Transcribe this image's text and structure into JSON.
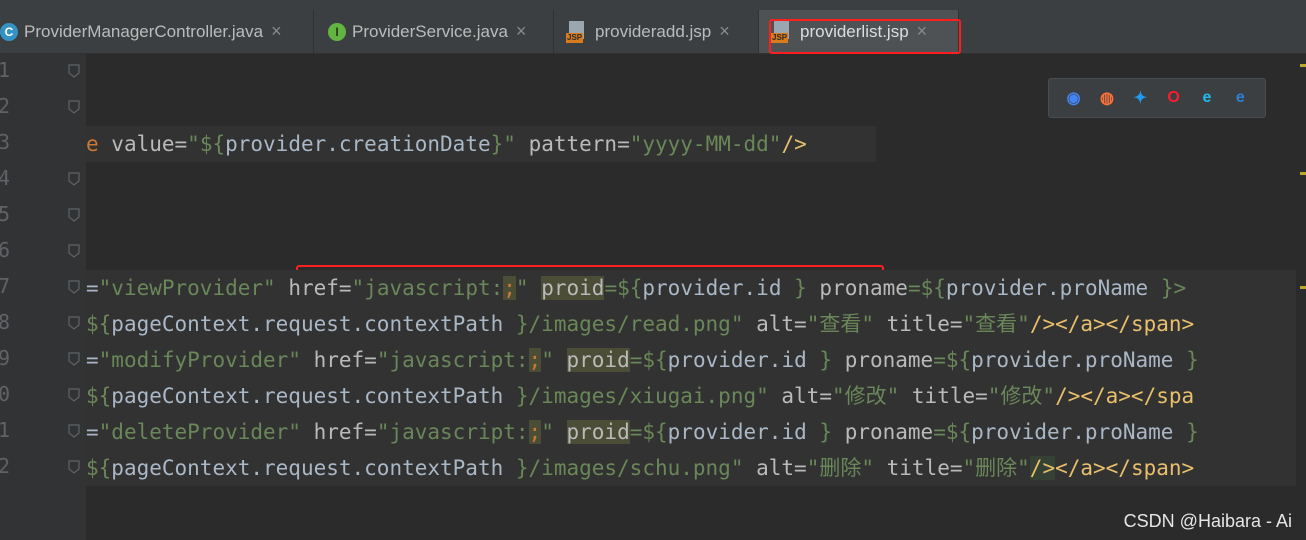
{
  "tabs": [
    {
      "label": "ProviderManagerController.java",
      "icon": "class-c-icon",
      "active": false
    },
    {
      "label": "ProviderService.java",
      "icon": "interface-i-icon",
      "active": false
    },
    {
      "label": "provideradd.jsp",
      "icon": "jsp-file-icon",
      "active": false
    },
    {
      "label": "providerlist.jsp",
      "icon": "jsp-file-icon",
      "active": true
    }
  ],
  "close_glyph": "×",
  "gutter": {
    "line_numbers": [
      "1",
      "2",
      "3",
      "4",
      "5",
      "6",
      "7",
      "8",
      "9",
      "0",
      "1",
      "2"
    ]
  },
  "code_lines": [
    {
      "segments": []
    },
    {
      "segments": []
    },
    {
      "segments": [
        {
          "t": "e",
          "c": "el"
        },
        {
          "t": " value=",
          "c": "attr"
        },
        {
          "t": "\"${",
          "c": "str"
        },
        {
          "t": "provider.creationDate",
          "c": "ident"
        },
        {
          "t": "}\"",
          "c": "str"
        },
        {
          "t": " pattern=",
          "c": "attr"
        },
        {
          "t": "\"yyyy-MM-dd\"",
          "c": "str"
        },
        {
          "t": "/>",
          "c": "tag"
        }
      ]
    },
    {
      "segments": []
    },
    {
      "segments": []
    },
    {
      "segments": []
    },
    {
      "segments": [
        {
          "t": "=",
          "c": "ident"
        },
        {
          "t": "\"viewProvider\"",
          "c": "str"
        },
        {
          "t": " ",
          "c": "ident"
        },
        {
          "t": "href=",
          "c": "attr"
        },
        {
          "t": "\"javascript:",
          "c": "str"
        },
        {
          "t": ";",
          "c": "el hl"
        },
        {
          "t": "\"",
          "c": "str"
        },
        {
          "t": " ",
          "c": "ident"
        },
        {
          "t": "proid",
          "c": "attr hl"
        },
        {
          "t": "=${",
          "c": "str"
        },
        {
          "t": "provider.id",
          "c": "ident"
        },
        {
          "t": " }",
          "c": "str"
        },
        {
          "t": " ",
          "c": "ident"
        },
        {
          "t": "proname",
          "c": "attr"
        },
        {
          "t": "=${",
          "c": "str"
        },
        {
          "t": "provider.proName",
          "c": "ident"
        },
        {
          "t": " }>",
          "c": "str"
        }
      ]
    },
    {
      "segments": [
        {
          "t": "${",
          "c": "str"
        },
        {
          "t": "pageContext.request.contextPath",
          "c": "ident"
        },
        {
          "t": " }",
          "c": "str"
        },
        {
          "t": "/images/read.png\"",
          "c": "str"
        },
        {
          "t": " alt=",
          "c": "attr"
        },
        {
          "t": "\"",
          "c": "str"
        },
        {
          "t": "查看",
          "c": "str"
        },
        {
          "t": "\"",
          "c": "str"
        },
        {
          "t": " title=",
          "c": "attr"
        },
        {
          "t": "\"查看\"",
          "c": "str"
        },
        {
          "t": "/></a></span>",
          "c": "tag"
        }
      ]
    },
    {
      "segments": [
        {
          "t": "=",
          "c": "ident"
        },
        {
          "t": "\"modifyProvider\"",
          "c": "str"
        },
        {
          "t": " href=",
          "c": "attr"
        },
        {
          "t": "\"javascript:",
          "c": "str"
        },
        {
          "t": ";",
          "c": "el hl"
        },
        {
          "t": "\"",
          "c": "str"
        },
        {
          "t": " ",
          "c": "ident"
        },
        {
          "t": "proid",
          "c": "attr hl"
        },
        {
          "t": "=${",
          "c": "str"
        },
        {
          "t": "provider.id",
          "c": "ident"
        },
        {
          "t": " }",
          "c": "str"
        },
        {
          "t": " ",
          "c": "ident"
        },
        {
          "t": "proname",
          "c": "attr"
        },
        {
          "t": "=${",
          "c": "str"
        },
        {
          "t": "provider.proName",
          "c": "ident"
        },
        {
          "t": " }",
          "c": "str"
        }
      ]
    },
    {
      "segments": [
        {
          "t": "${",
          "c": "str"
        },
        {
          "t": "pageContext.request.contextPath",
          "c": "ident"
        },
        {
          "t": " }",
          "c": "str"
        },
        {
          "t": "/images/xiugai.png\"",
          "c": "str"
        },
        {
          "t": " alt=",
          "c": "attr"
        },
        {
          "t": "\"修改\"",
          "c": "str"
        },
        {
          "t": " title=",
          "c": "attr"
        },
        {
          "t": "\"修改\"",
          "c": "str"
        },
        {
          "t": "/></a></spa",
          "c": "tag"
        }
      ]
    },
    {
      "segments": [
        {
          "t": "=",
          "c": "ident"
        },
        {
          "t": "\"deleteProvider\"",
          "c": "str"
        },
        {
          "t": " href=",
          "c": "attr"
        },
        {
          "t": "\"javascript:",
          "c": "str"
        },
        {
          "t": ";",
          "c": "el hl"
        },
        {
          "t": "\"",
          "c": "str"
        },
        {
          "t": " ",
          "c": "ident"
        },
        {
          "t": "proid",
          "c": "attr hl"
        },
        {
          "t": "=${",
          "c": "str"
        },
        {
          "t": "provider.id",
          "c": "ident"
        },
        {
          "t": " }",
          "c": "str"
        },
        {
          "t": " ",
          "c": "ident"
        },
        {
          "t": "proname",
          "c": "attr"
        },
        {
          "t": "=${",
          "c": "str"
        },
        {
          "t": "provider.proName",
          "c": "ident"
        },
        {
          "t": " }",
          "c": "str"
        }
      ]
    },
    {
      "segments": [
        {
          "t": "${",
          "c": "str"
        },
        {
          "t": "pageContext.request.contextPath",
          "c": "ident"
        },
        {
          "t": " }",
          "c": "str"
        },
        {
          "t": "/images/schu.png\"",
          "c": "str"
        },
        {
          "t": " alt=",
          "c": "attr"
        },
        {
          "t": "\"删除\"",
          "c": "str"
        },
        {
          "t": " title=",
          "c": "attr"
        },
        {
          "t": "\"删除\"",
          "c": "str"
        },
        {
          "t": "/>",
          "c": "tag hl2"
        },
        {
          "t": "</a></span>",
          "c": "tag"
        }
      ]
    }
  ],
  "browser_icons": [
    {
      "name": "chrome-icon",
      "color": "#4285f4"
    },
    {
      "name": "firefox-icon",
      "color": "#ff7139"
    },
    {
      "name": "safari-icon",
      "color": "#1e9bf0"
    },
    {
      "name": "opera-icon",
      "color": "#ff1b2d"
    },
    {
      "name": "internet-explorer-icon",
      "color": "#1ebbee"
    },
    {
      "name": "edge-icon",
      "color": "#2f7ed8"
    }
  ],
  "watermark": "CSDN @Haibara - Ai",
  "colors": {
    "highlight_box": "#ff1e1e"
  }
}
